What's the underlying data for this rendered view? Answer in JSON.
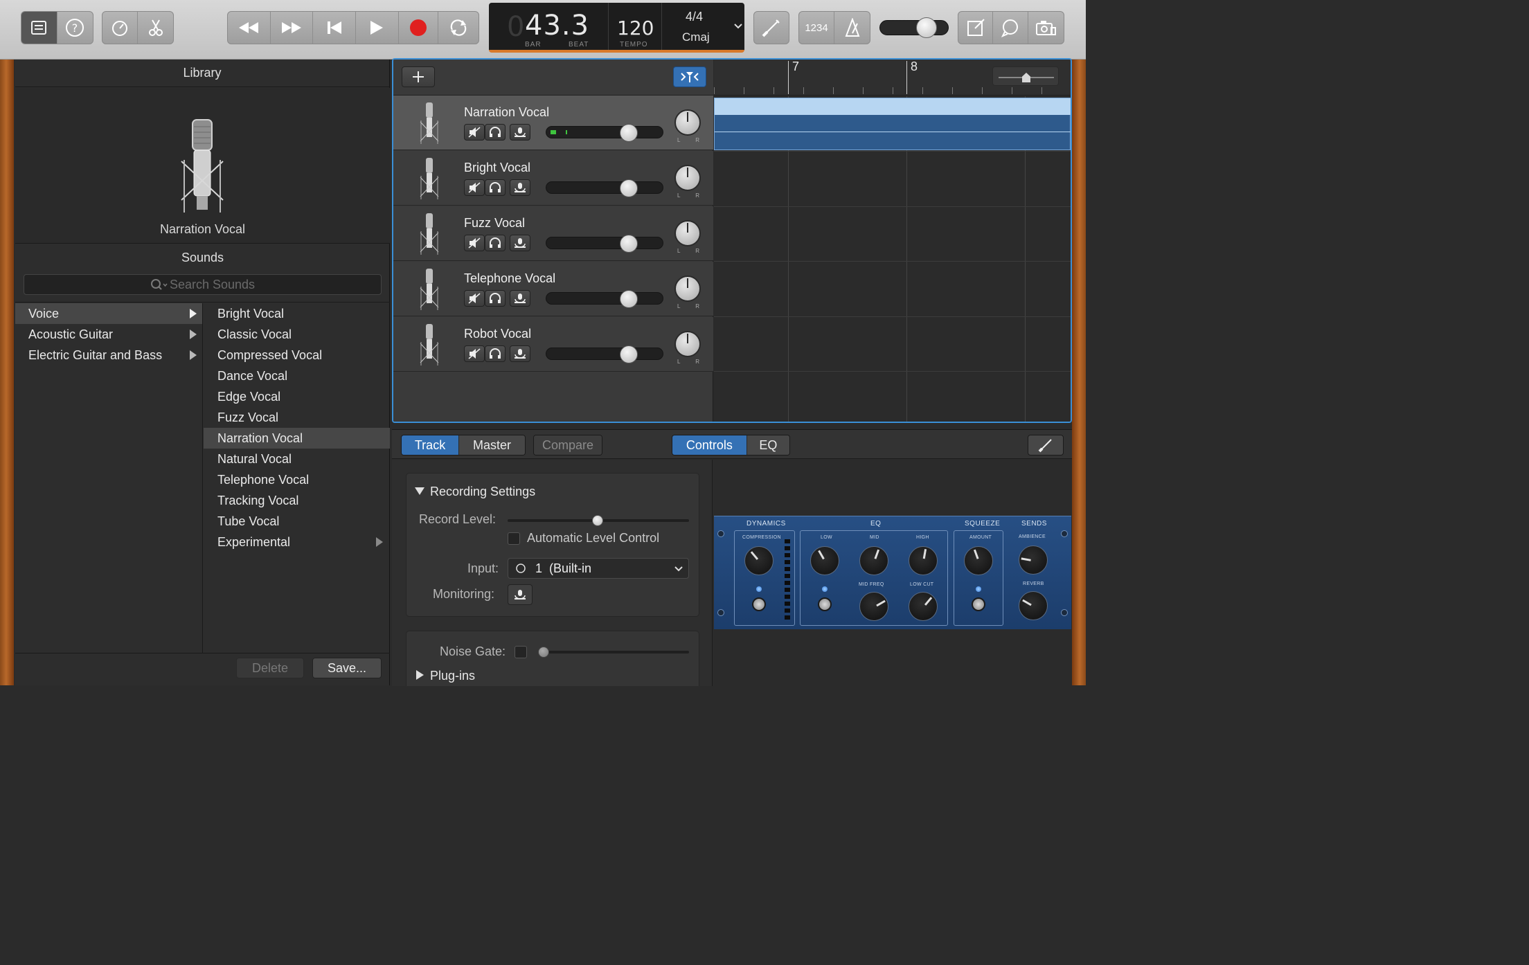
{
  "toolbar": {
    "icons": [
      "library-icon",
      "help-icon",
      "smart-controls-icon",
      "editors-icon",
      "rewind-icon",
      "fast-forward-icon",
      "go-to-beginning-icon",
      "play-icon",
      "record-icon",
      "cycle-icon",
      "tuner-icon",
      "count-in-icon",
      "metronome-icon",
      "master-volume-slider",
      "note-pad-icon",
      "loop-browser-icon",
      "media-browser-icon"
    ],
    "count_in_label": "1234",
    "colors": {
      "record": "#e0201f",
      "lcd_accent": "#d8792a",
      "selection": "#3a8fd6"
    }
  },
  "lcd": {
    "position": "43.3",
    "bar_label": "BAR",
    "beat_label": "BEAT",
    "tempo": "120",
    "tempo_label": "TEMPO",
    "time_signature": "4/4",
    "key": "Cmaj"
  },
  "library": {
    "title": "Library",
    "patch_name": "Narration Vocal",
    "sounds_header": "Sounds",
    "search_placeholder": "Search Sounds",
    "categories": [
      {
        "label": "Voice",
        "selected": true
      },
      {
        "label": "Acoustic Guitar"
      },
      {
        "label": "Electric Guitar and Bass"
      }
    ],
    "sounds": [
      {
        "label": "Bright Vocal"
      },
      {
        "label": "Classic Vocal"
      },
      {
        "label": "Compressed Vocal"
      },
      {
        "label": "Dance Vocal"
      },
      {
        "label": "Edge Vocal"
      },
      {
        "label": "Fuzz Vocal"
      },
      {
        "label": "Narration Vocal",
        "selected": true
      },
      {
        "label": "Natural Vocal"
      },
      {
        "label": "Telephone Vocal"
      },
      {
        "label": "Tracking Vocal"
      },
      {
        "label": "Tube Vocal"
      },
      {
        "label": "Experimental"
      }
    ],
    "delete_label": "Delete",
    "save_label": "Save..."
  },
  "ruler": {
    "bar_7": "7",
    "bar_8": "8"
  },
  "tracks": [
    {
      "name": "Narration Vocal",
      "selected": true
    },
    {
      "name": "Bright Vocal"
    },
    {
      "name": "Fuzz Vocal"
    },
    {
      "name": "Telephone Vocal"
    },
    {
      "name": "Robot Vocal"
    }
  ],
  "track_controls": {
    "pan_left": "L",
    "pan_right": "R"
  },
  "smart_controls": {
    "tabs": {
      "track": "Track",
      "master": "Master",
      "compare": "Compare"
    },
    "view_tabs": {
      "controls": "Controls",
      "eq": "EQ"
    },
    "recording_settings": {
      "title": "Recording Settings",
      "record_level_label": "Record Level:",
      "auto_level_label": "Automatic Level Control",
      "input_label": "Input:",
      "input_channel": "1",
      "input_value": "(Built-in",
      "monitoring_label": "Monitoring:"
    },
    "noise_gate_label": "Noise Gate:",
    "plugins_label": "Plug-ins"
  },
  "plugin": {
    "dynamics": "DYNAMICS",
    "compression": "COMPRESSION",
    "eq": "EQ",
    "low": "LOW",
    "mid": "MID",
    "high": "HIGH",
    "mid_freq": "MID FREQ",
    "low_cut": "LOW CUT",
    "squeeze": "SQUEEZE",
    "amount": "AMOUNT",
    "sends": "SENDS",
    "ambience": "AMBIENCE",
    "reverb": "REVERB"
  }
}
